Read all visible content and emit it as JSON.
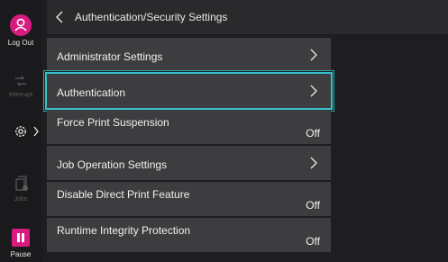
{
  "rail": {
    "logout_label": "Log Out",
    "interrupt_label": "Interrupt",
    "jobs_label": "Jobs",
    "pause_label": "Pause"
  },
  "header": {
    "title": "Authentication/Security Settings"
  },
  "items": [
    {
      "label": "Administrator Settings",
      "value": ""
    },
    {
      "label": "Authentication",
      "value": ""
    },
    {
      "label": "Force Print Suspension",
      "value": "Off"
    },
    {
      "label": "Job Operation Settings",
      "value": ""
    },
    {
      "label": "Disable Direct Print Feature",
      "value": "Off"
    },
    {
      "label": "Runtime Integrity Protection",
      "value": "Off"
    }
  ],
  "colors": {
    "accent": "#d81b7e",
    "selection": "#35c1c7"
  }
}
